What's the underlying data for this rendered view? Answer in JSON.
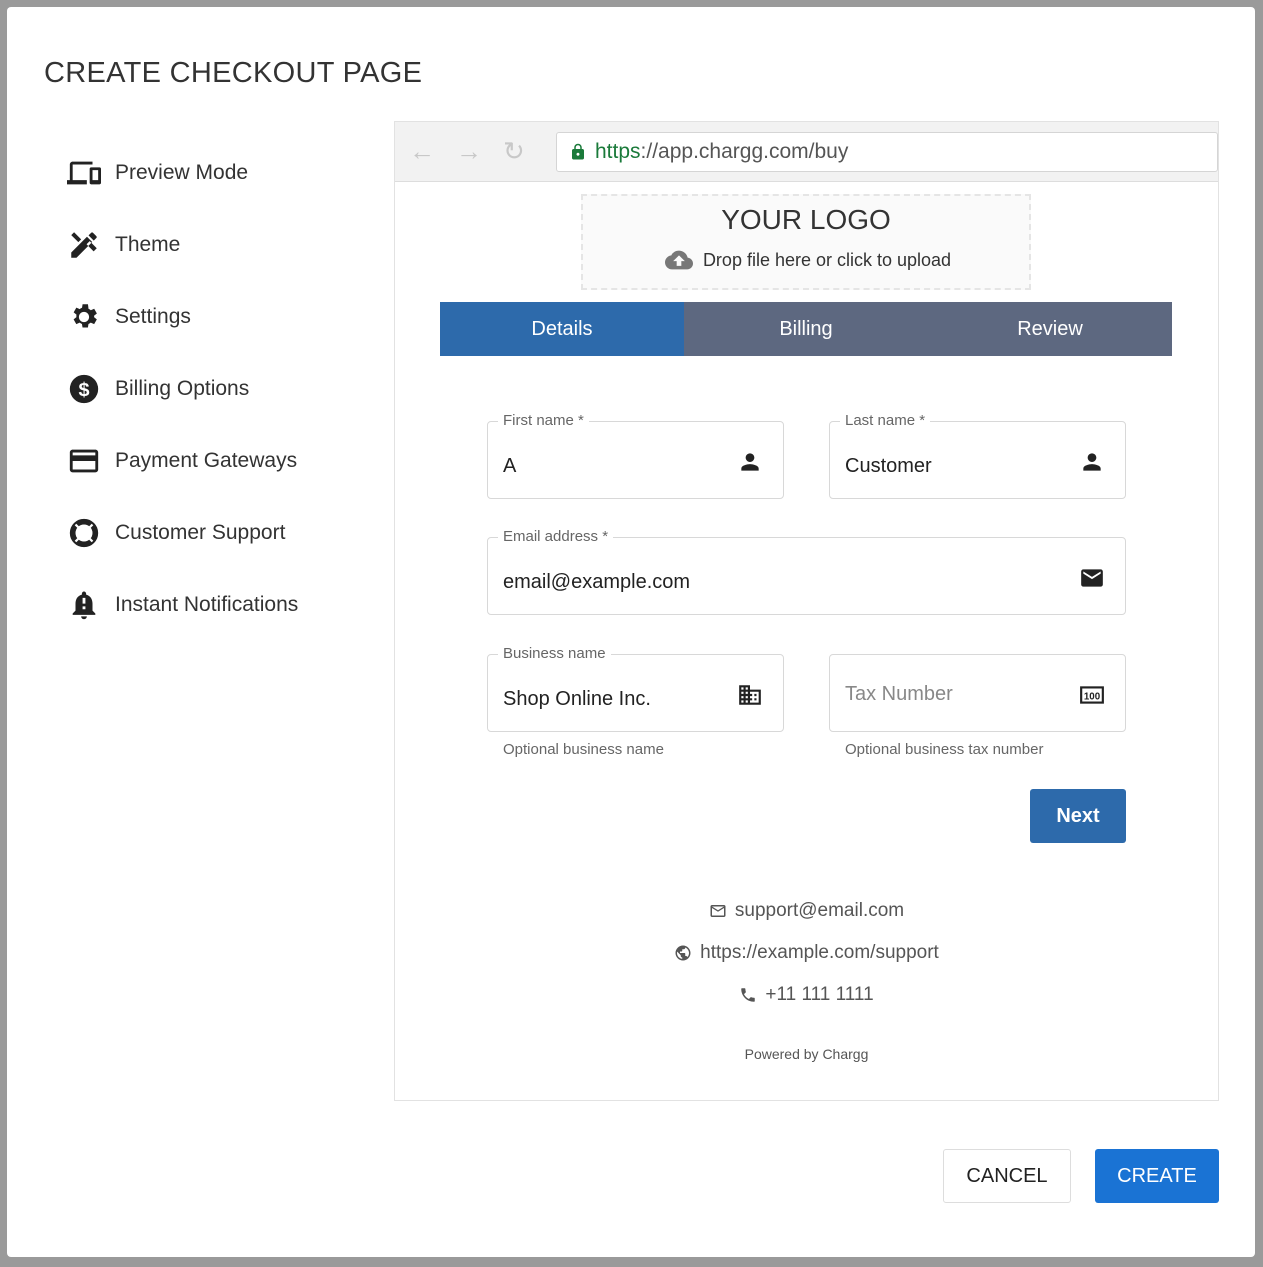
{
  "title": "CREATE CHECKOUT PAGE",
  "nav": [
    {
      "label": "Preview Mode",
      "icon": "devices-icon"
    },
    {
      "label": "Theme",
      "icon": "theme-tools-icon"
    },
    {
      "label": "Settings",
      "icon": "gear-icon"
    },
    {
      "label": "Billing Options",
      "icon": "dollar-icon"
    },
    {
      "label": "Payment Gateways",
      "icon": "credit-card-icon"
    },
    {
      "label": "Customer Support",
      "icon": "lifebuoy-icon"
    },
    {
      "label": "Instant Notifications",
      "icon": "bell-icon"
    }
  ],
  "browser": {
    "url_scheme": "https",
    "url_rest": "://app.chargg.com/buy"
  },
  "logo": {
    "title": "YOUR LOGO",
    "upload": "Drop file here or click to upload"
  },
  "tabs": [
    "Details",
    "Billing",
    "Review"
  ],
  "form": {
    "first_name": {
      "label": "First name *",
      "value": "A"
    },
    "last_name": {
      "label": "Last name *",
      "value": "Customer"
    },
    "email": {
      "label": "Email address *",
      "value": "email@example.com"
    },
    "business": {
      "label": "Business name",
      "value": "Shop Online Inc.",
      "hint": "Optional business name"
    },
    "tax": {
      "placeholder": "Tax Number",
      "hint": "Optional business tax number"
    },
    "next": "Next"
  },
  "contact": {
    "email": "support@email.com",
    "url": "https://example.com/support",
    "phone": "+11 111 1111"
  },
  "powered": "Powered by Chargg",
  "actions": {
    "cancel": "CANCEL",
    "create": "CREATE"
  }
}
